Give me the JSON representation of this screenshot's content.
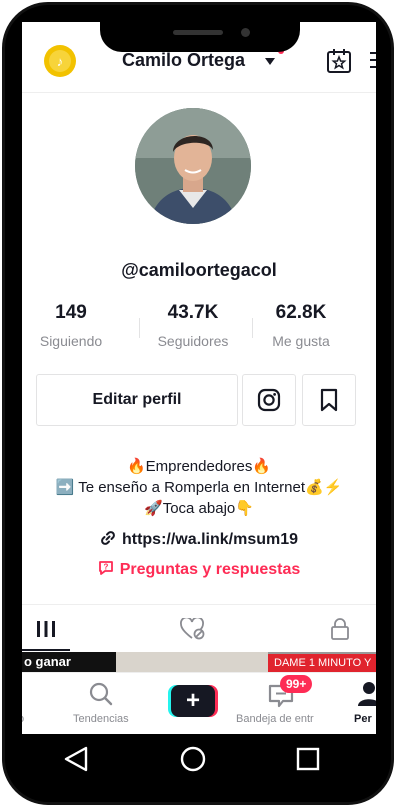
{
  "header": {
    "username": "Camilo Ortega"
  },
  "profile": {
    "handle": "@camiloortegacol"
  },
  "stats": [
    {
      "value": "149",
      "label": "Siguiendo"
    },
    {
      "value": "43.7K",
      "label": "Seguidores"
    },
    {
      "value": "62.8K",
      "label": "Me gusta"
    }
  ],
  "actions": {
    "edit_label": "Editar perfil"
  },
  "bio": {
    "line1": "🔥Emprendedores🔥",
    "line2": "➡️ Te enseño a Romperla en Internet💰⚡",
    "line3": "🚀Toca abajo👇",
    "link": "https://wa.link/msum19",
    "qa": "Preguntas y respuestas"
  },
  "thumbnails": {
    "left_text": "o ganar",
    "right_text": "DAME 1 MINUTO Y"
  },
  "nav": {
    "items": [
      "o",
      "Tendencias",
      "Bandeja de entr",
      "Per"
    ],
    "badge": "99+"
  },
  "colors": {
    "accent": "#fe2c55",
    "coin": "#f2c200",
    "text": "#161823",
    "muted": "#8a8b91"
  }
}
